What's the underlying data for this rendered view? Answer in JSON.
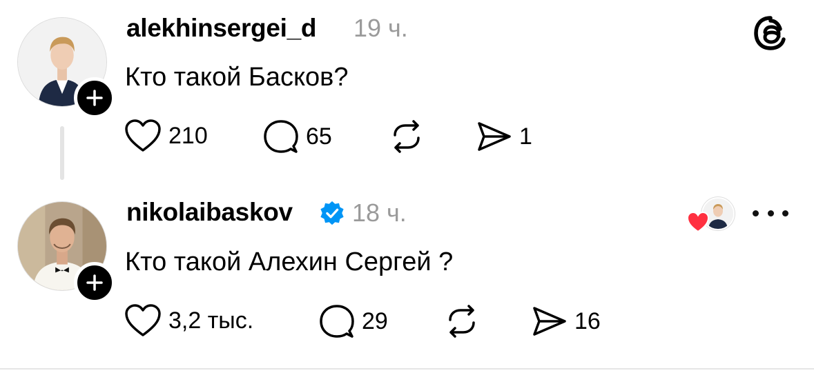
{
  "posts": [
    {
      "username": "alekhinsergei_d",
      "time": "19 ч.",
      "text": "Кто такой Басков?",
      "likes": "210",
      "comments": "65",
      "shares": "1"
    },
    {
      "username": "nikolaibaskov",
      "verified": true,
      "time": "18 ч.",
      "text": "Кто такой Алехин Сергей ?",
      "likes": "3,2 тыс.",
      "comments": "29",
      "shares": "16"
    }
  ],
  "icons": {
    "app": "threads-logo-icon",
    "follow": "plus-icon",
    "like": "heart-outline-icon",
    "comment": "comment-bubble-icon",
    "repost": "repost-icon",
    "share": "send-icon",
    "liked_by": "red-heart-icon",
    "more": "more-horizontal-icon"
  },
  "colors": {
    "text": "#000000",
    "secondary": "#9a9a9a",
    "verified": "#0095f6",
    "liked_heart": "#ff3040",
    "thread_line": "#e4e4e4"
  }
}
